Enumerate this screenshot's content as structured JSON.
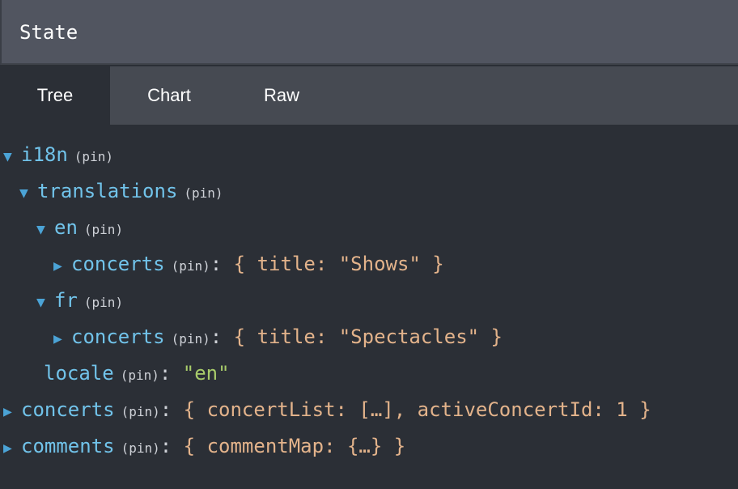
{
  "header": {
    "title": "State"
  },
  "tabs": [
    {
      "label": "Tree",
      "active": true
    },
    {
      "label": "Chart",
      "active": false
    },
    {
      "label": "Raw",
      "active": false
    }
  ],
  "tree": {
    "pin_label": "(pin)",
    "i18n": {
      "key": "i18n",
      "expanded": true
    },
    "translations": {
      "key": "translations",
      "expanded": true
    },
    "en": {
      "key": "en",
      "expanded": true
    },
    "en_concerts": {
      "key": "concerts",
      "preview": "{ title: \"Shows\" }"
    },
    "fr": {
      "key": "fr",
      "expanded": true
    },
    "fr_concerts": {
      "key": "concerts",
      "preview": "{ title: \"Spectacles\" }"
    },
    "locale": {
      "key": "locale",
      "value": "\"en\""
    },
    "concerts": {
      "key": "concerts",
      "preview": "{ concertList: […], activeConcertId: 1 }"
    },
    "comments": {
      "key": "comments",
      "preview": "{ commentMap: {…} }"
    }
  },
  "colors": {
    "background": "#2b2f36",
    "header_bg": "#515560",
    "tabbar_bg": "#464a52",
    "key": "#71c3ea",
    "value": "#e3b38b",
    "string": "#a8cc6a"
  }
}
